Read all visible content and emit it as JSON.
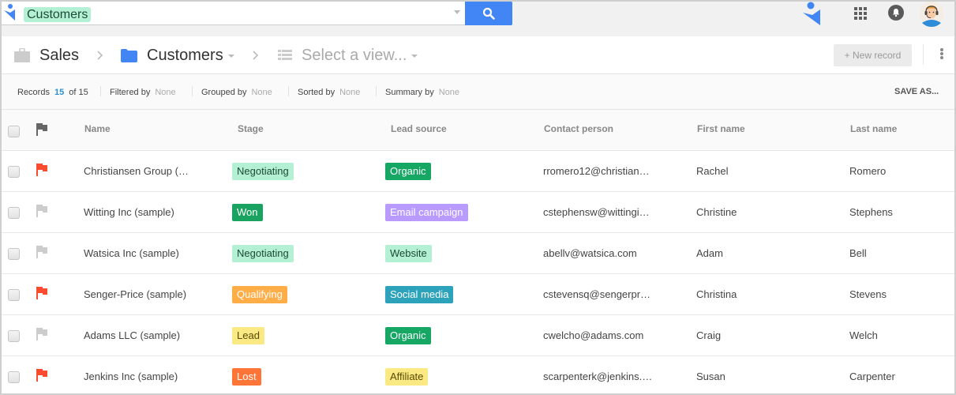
{
  "topbar": {
    "search_chip": "Customers",
    "search_button_icon": "search-icon",
    "apps_icon": "apps-grid-icon",
    "notifications_icon": "bell-icon",
    "avatar_icon": "user-avatar-icon",
    "brand_color": "#4285f4"
  },
  "breadcrumb": {
    "items": [
      {
        "label": "Sales",
        "icon": "briefcase-icon"
      },
      {
        "label": "Customers",
        "icon": "folder-icon"
      },
      {
        "label": "Select a view...",
        "icon": "list-view-icon"
      }
    ]
  },
  "actions": {
    "new_record": "+ New record",
    "more_icon": "more-vertical-icon"
  },
  "summary": {
    "records_label": "Records",
    "records_count": "15",
    "records_total": "of 15",
    "filtered_label": "Filtered by",
    "filtered_value": "None",
    "grouped_label": "Grouped by",
    "grouped_value": "None",
    "sorted_label": "Sorted by",
    "sorted_value": "None",
    "summary_label": "Summary by",
    "summary_value": "None",
    "save_as": "SAVE AS..."
  },
  "table": {
    "columns": [
      "Name",
      "Stage",
      "Lead source",
      "Contact person",
      "First name",
      "Last name"
    ],
    "rows": [
      {
        "flagged": true,
        "name": "Christiansen Group (…",
        "stage": "Negotiating",
        "lead_source": "Organic",
        "contact": "rromero12@christian…",
        "first": "Rachel",
        "last": "Romero"
      },
      {
        "flagged": false,
        "name": "Witting Inc (sample)",
        "stage": "Won",
        "lead_source": "Email campaign",
        "contact": "cstephensw@wittingi…",
        "first": "Christine",
        "last": "Stephens"
      },
      {
        "flagged": false,
        "name": "Watsica Inc (sample)",
        "stage": "Negotiating",
        "lead_source": "Website",
        "contact": "abellv@watsica.com",
        "first": "Adam",
        "last": "Bell"
      },
      {
        "flagged": true,
        "name": "Senger-Price (sample)",
        "stage": "Qualifying",
        "lead_source": "Social media",
        "contact": "cstevensq@sengerpr…",
        "first": "Christina",
        "last": "Stevens"
      },
      {
        "flagged": false,
        "name": "Adams LLC (sample)",
        "stage": "Lead",
        "lead_source": "Organic",
        "contact": "cwelcho@adams.com",
        "first": "Craig",
        "last": "Welch"
      },
      {
        "flagged": true,
        "name": "Jenkins Inc (sample)",
        "stage": "Lost",
        "lead_source": "Affiliate",
        "contact": "scarpenterk@jenkins.…",
        "first": "Susan",
        "last": "Carpenter"
      }
    ]
  },
  "badge_colors": {
    "Negotiating": {
      "bg": "#b3f0d4",
      "fg": "#1d4a36"
    },
    "Won": {
      "bg": "#1aa260",
      "fg": "#ffffff"
    },
    "Qualifying": {
      "bg": "#ffad47",
      "fg": "#ffffff"
    },
    "Lead": {
      "bg": "#fbe983",
      "fg": "#594c05"
    },
    "Lost": {
      "bg": "#ff7537",
      "fg": "#ffffff"
    },
    "Organic": {
      "bg": "#16a765",
      "fg": "#ffffff"
    },
    "Email campaign": {
      "bg": "#b99aff",
      "fg": "#ffffff"
    },
    "Website": {
      "bg": "#b3f0d4",
      "fg": "#1d4a36"
    },
    "Social media": {
      "bg": "#2da2bb",
      "fg": "#ffffff"
    },
    "Affiliate": {
      "bg": "#fbe983",
      "fg": "#594c05"
    }
  },
  "flag_colors": {
    "on": "#fb4c2f",
    "off": "#cccccc",
    "header": "#666666"
  }
}
